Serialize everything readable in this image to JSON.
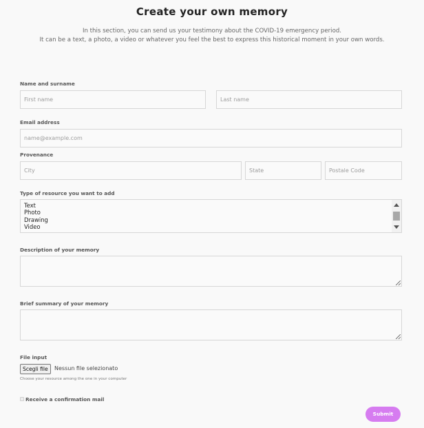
{
  "header": {
    "title": "Create your own memory",
    "intro_line1": "In this section, you can send us your testimony about the COVID-19 emergency period.",
    "intro_line2": "It can be a text, a photo, a video or whatever you feel the best to express this historical moment in your own words."
  },
  "form": {
    "name": {
      "label": "Name and surname",
      "first_placeholder": "First name",
      "last_placeholder": "Last name"
    },
    "email": {
      "label": "Email address",
      "placeholder": "name@example.com"
    },
    "provenance": {
      "label": "Provenance",
      "city_placeholder": "City",
      "state_placeholder": "State",
      "postal_placeholder": "Postale Code"
    },
    "resource_type": {
      "label": "Type of resource you want to add",
      "options": [
        "Text",
        "Photo",
        "Drawing",
        "Video"
      ]
    },
    "description": {
      "label": "Description of your memory"
    },
    "summary": {
      "label": "Brief summary of your memory"
    },
    "file": {
      "label": "File input",
      "button": "Scegli file",
      "status": "Nessun file selezionato",
      "help": "Choose your resource among the one in your computer"
    },
    "confirmation": {
      "label": "Receive a confirmation mail",
      "checked": false
    },
    "submit_label": "Submit"
  },
  "colors": {
    "submit_button": "#d67cf0",
    "background": "#f9f9f9",
    "field_border": "#d6d6d6"
  }
}
